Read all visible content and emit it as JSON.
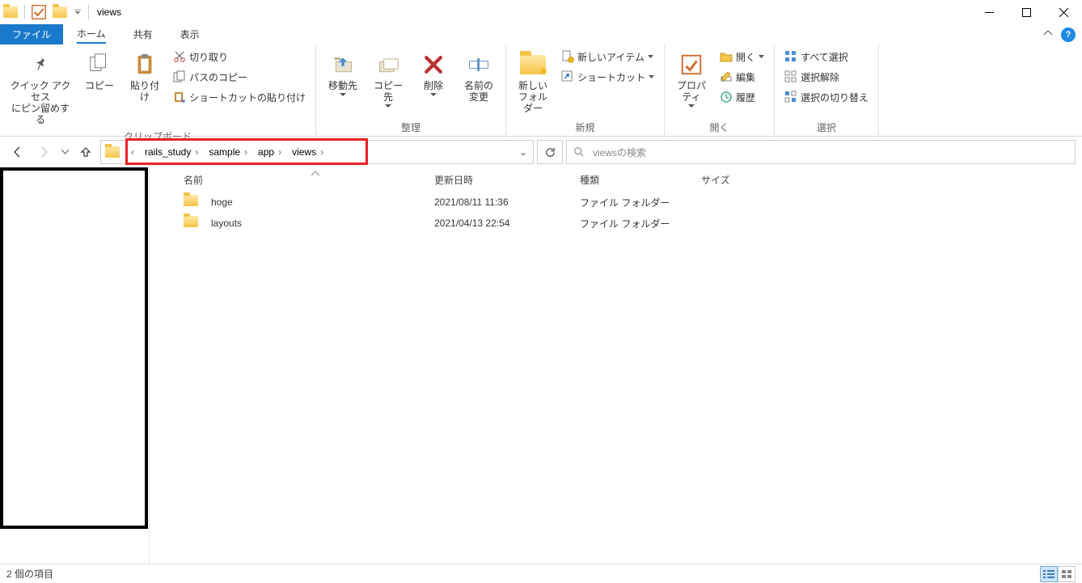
{
  "title": "views",
  "tabs": {
    "file": "ファイル",
    "home": "ホーム",
    "share": "共有",
    "view": "表示"
  },
  "ribbon": {
    "clipboard": {
      "pin": "クイック アクセス\nにピン留めする",
      "copy": "コピー",
      "paste": "貼り付け",
      "cut": "切り取り",
      "copypath": "パスのコピー",
      "pasteshortcut": "ショートカットの貼り付け",
      "group": "クリップボード"
    },
    "organize": {
      "moveto": "移動先",
      "copyto": "コピー先",
      "delete": "削除",
      "rename": "名前の\n変更",
      "group": "整理"
    },
    "new": {
      "newfolder": "新しい\nフォルダー",
      "newitem": "新しいアイテム",
      "shortcut": "ショートカット",
      "group": "新規"
    },
    "open": {
      "properties": "プロパティ",
      "open": "開く",
      "edit": "編集",
      "history": "履歴",
      "group": "開く"
    },
    "select": {
      "selectall": "すべて選択",
      "selectnone": "選択解除",
      "invert": "選択の切り替え",
      "group": "選択"
    }
  },
  "breadcrumb": [
    "rails_study",
    "sample",
    "app",
    "views"
  ],
  "search_placeholder": "viewsの検索",
  "columns": {
    "name": "名前",
    "date": "更新日時",
    "type": "種類",
    "size": "サイズ"
  },
  "rows": [
    {
      "name": "hoge",
      "date": "2021/08/11 11:36",
      "type": "ファイル フォルダー"
    },
    {
      "name": "layouts",
      "date": "2021/04/13 22:54",
      "type": "ファイル フォルダー"
    }
  ],
  "status": "2 個の項目"
}
